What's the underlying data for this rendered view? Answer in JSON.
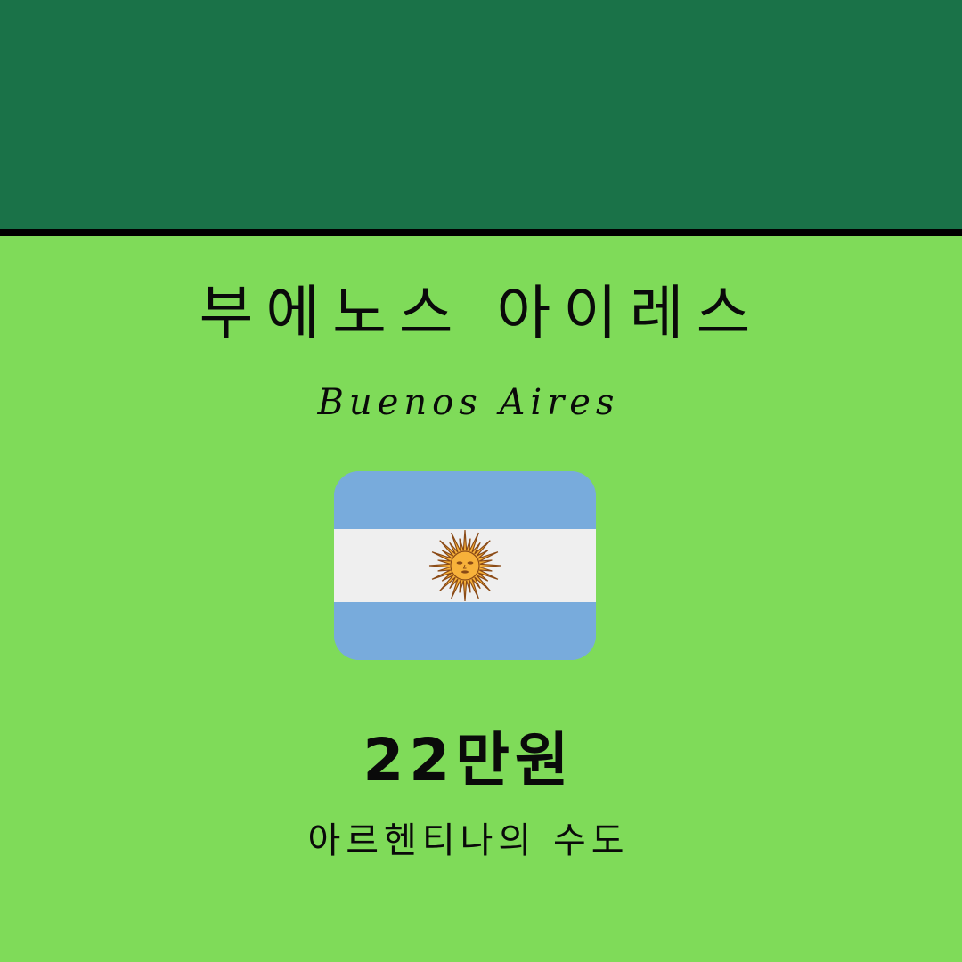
{
  "header": {
    "title_ko": "부에노스 아이레스",
    "title_en": "Buenos Aires"
  },
  "flag": {
    "icon": "argentina-flag-icon",
    "colors": {
      "blue": "#78abdc",
      "white": "#efefef",
      "sun": "#f7b13a",
      "sun_outline": "#8a4a16"
    }
  },
  "stats": {
    "population": "22만원",
    "caption": "아르헨티나의 수도"
  },
  "colors": {
    "top_band": "#1a7248",
    "background": "#7fdb59",
    "divider": "#000000",
    "text": "#0a0a0a"
  }
}
